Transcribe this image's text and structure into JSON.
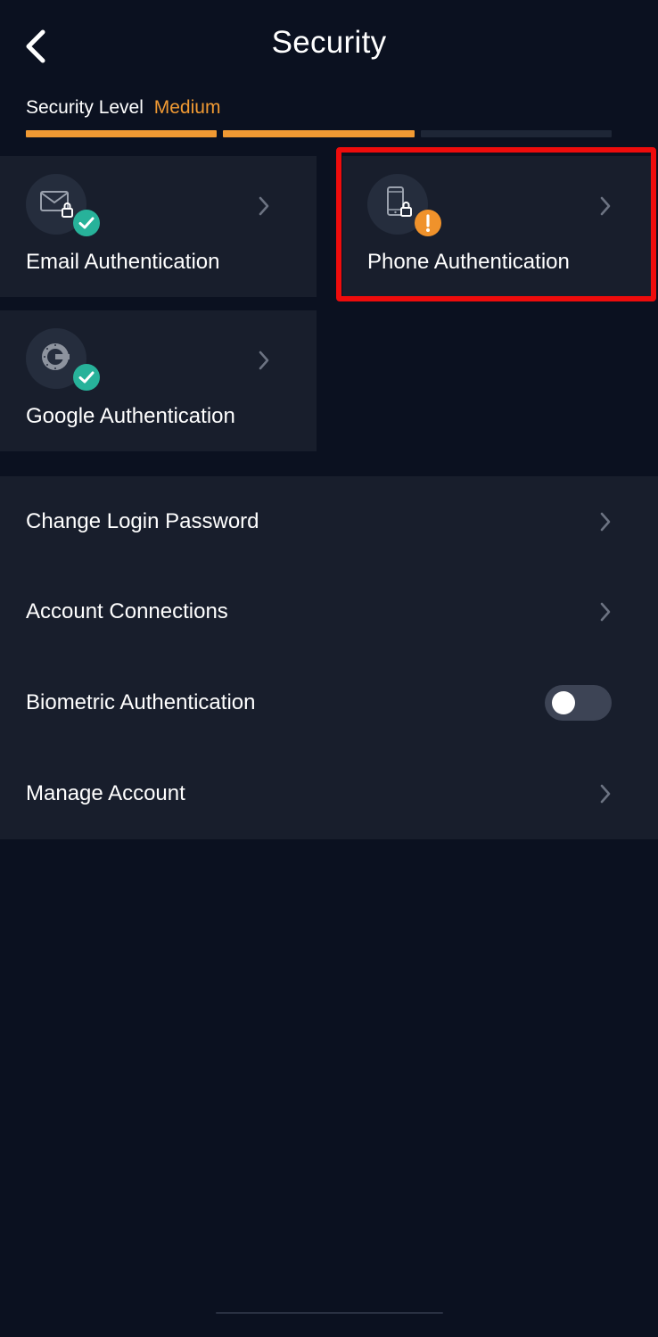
{
  "header": {
    "title": "Security",
    "back_icon": "chevron-left-icon"
  },
  "security_level": {
    "label": "Security Level",
    "value": "Medium",
    "segments_total": 3,
    "segments_filled": 2,
    "filled_color": "#f19a33",
    "empty_color": "#1e2636"
  },
  "auth_cards": [
    {
      "label": "Email Authentication",
      "icon": "mail-lock-icon",
      "status": "verified",
      "status_icon": "check-badge-icon"
    },
    {
      "label": "Phone Authentication",
      "icon": "phone-lock-icon",
      "status": "warning",
      "status_icon": "exclamation-badge-icon",
      "highlighted": true
    },
    {
      "label": "Google Authentication",
      "icon": "google-authenticator-icon",
      "status": "verified",
      "status_icon": "check-badge-icon"
    }
  ],
  "settings": [
    {
      "label": "Change Login Password",
      "control": "chevron"
    },
    {
      "label": "Account Connections",
      "control": "chevron"
    },
    {
      "label": "Biometric Authentication",
      "control": "toggle",
      "enabled": false
    },
    {
      "label": "Manage Account",
      "control": "chevron"
    }
  ],
  "colors": {
    "background": "#0b1120",
    "card": "#181e2c",
    "accent_orange": "#f19a33",
    "verified_green": "#27b29a",
    "warning_orange": "#f0922b",
    "highlight_red": "#ee0c0c"
  }
}
